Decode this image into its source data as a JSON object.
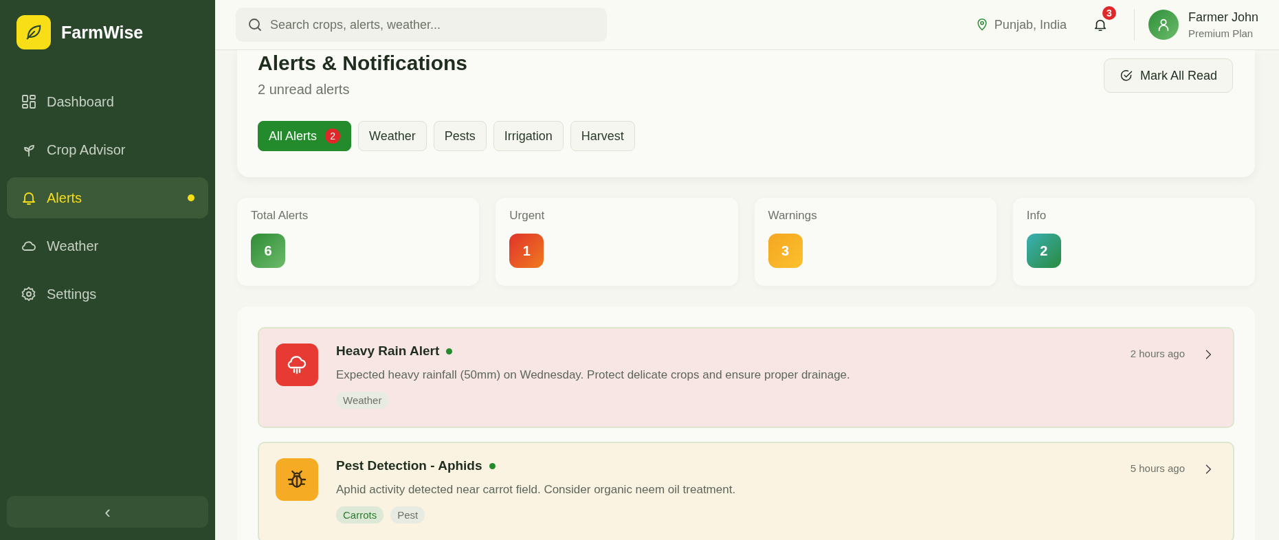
{
  "sidebar": {
    "brand": "FarmWise",
    "items": [
      {
        "label": "Dashboard",
        "kind": "grid",
        "selected": false,
        "unread": false
      },
      {
        "label": "Crop Advisor",
        "kind": "sprout",
        "selected": false,
        "unread": false
      },
      {
        "label": "Alerts",
        "kind": "bell",
        "selected": true,
        "unread": true
      },
      {
        "label": "Weather",
        "kind": "cloud",
        "selected": false,
        "unread": false
      },
      {
        "label": "Settings",
        "kind": "gear",
        "selected": false,
        "unread": false
      }
    ],
    "collapse": "‹"
  },
  "header": {
    "search": {
      "placeholder": "Search crops, alerts, weather..."
    },
    "location": "Punjab, India",
    "notifications": "3",
    "user": {
      "name": "Farmer John",
      "plan": "Premium Plan"
    }
  },
  "page": {
    "title": "Alerts & Notifications",
    "subtitle": "2 unread alerts",
    "action": "Mark All Read",
    "filters": [
      {
        "label": "All Alerts",
        "badge": "2",
        "selected": true
      },
      {
        "label": "Weather",
        "selected": false
      },
      {
        "label": "Pests",
        "selected": false
      },
      {
        "label": "Irrigation",
        "selected": false
      },
      {
        "label": "Harvest",
        "selected": false
      }
    ]
  },
  "stats": [
    {
      "label": "Total Alerts",
      "value": "6",
      "kind": "total"
    },
    {
      "label": "Urgent",
      "value": "1",
      "kind": "urgent"
    },
    {
      "label": "Warnings",
      "value": "3",
      "kind": "warning"
    },
    {
      "label": "Info",
      "value": "2",
      "kind": "info"
    }
  ],
  "alerts": [
    {
      "title": "Heavy Rain Alert",
      "kind": "rain",
      "unread": true,
      "time": "2 hours ago",
      "message": "Expected heavy rainfall (50mm) on Wednesday. Protect delicate crops and ensure proper drainage.",
      "tags": [
        {
          "label": "Weather",
          "kind": "category"
        }
      ]
    },
    {
      "title": "Pest Detection - Aphids",
      "kind": "pest",
      "unread": true,
      "time": "5 hours ago",
      "message": "Aphid activity detected near carrot field. Consider organic neem oil treatment.",
      "tags": [
        {
          "label": "Carrots",
          "kind": "crop"
        },
        {
          "label": "Pest",
          "kind": "category"
        }
      ]
    }
  ]
}
